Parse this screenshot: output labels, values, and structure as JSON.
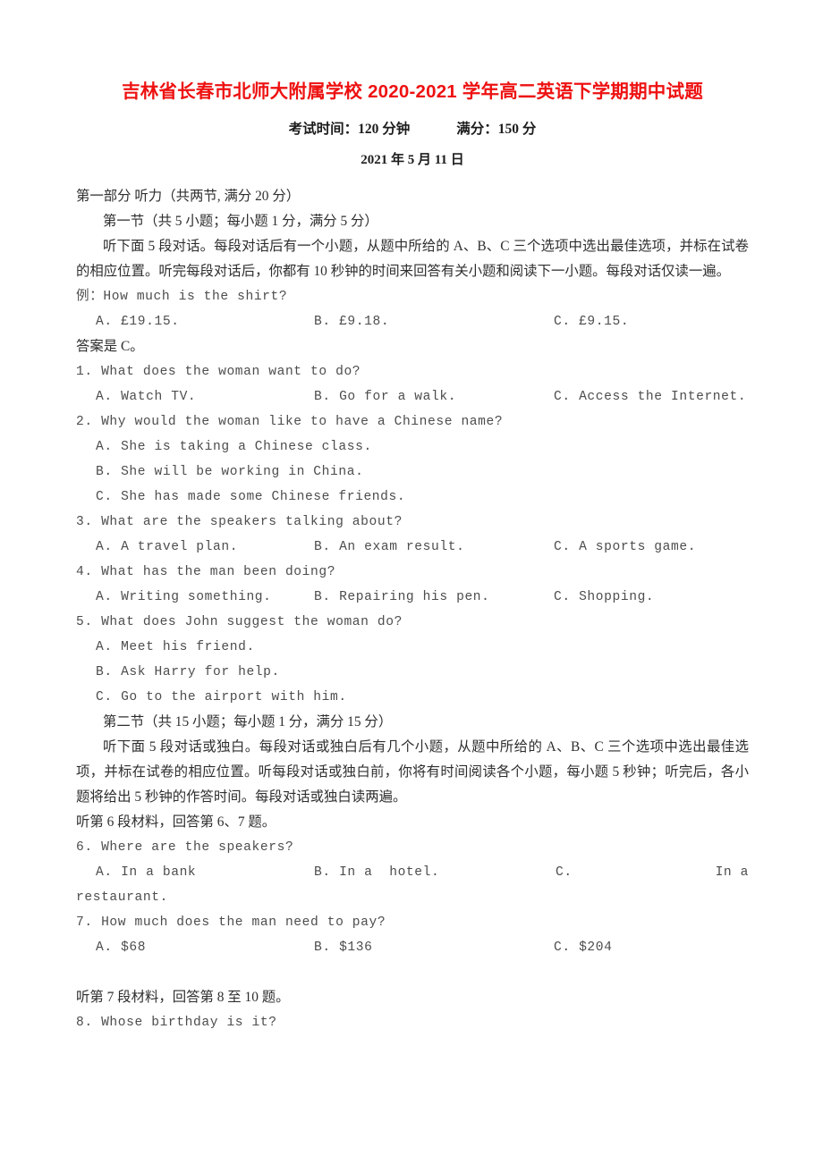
{
  "document": {
    "title": "吉林省长春市北师大附属学校 2020-2021 学年高二英语下学期期中试题",
    "exam_time_label": "考试时间：120 分钟",
    "full_marks_label": "满分：150 分",
    "date": "2021 年 5 月 11 日"
  },
  "part_one": {
    "heading": "第一部分 听力（共两节, 满分 20 分）",
    "section_one": {
      "heading": "第一节（共 5 小题；每小题 1 分，满分 5 分）",
      "instructions": "听下面 5 段对话。每段对话后有一个小题，从题中所给的 A、B、C 三个选项中选出最佳选项，并标在试卷的相应位置。听完每段对话后，你都有 10 秒钟的时间来回答有关小题和阅读下一小题。每段对话仅读一遍。",
      "example_label": "例：How much is the shirt?",
      "example_options": {
        "a": "A. £19.15.",
        "b": "B. £9.18.",
        "c": "C. £9.15."
      },
      "answer_line": "答案是 C。",
      "questions": [
        {
          "number": "1.",
          "stem": "1. What does the woman want to do?",
          "layout": "row",
          "options": {
            "a": "A. Watch TV.",
            "b": "B. Go for a walk.",
            "c": "C. Access the Internet."
          }
        },
        {
          "number": "2.",
          "stem": "2. Why would the woman like to have a Chinese name?",
          "layout": "stack",
          "options": {
            "a": "A. She is taking a Chinese class.",
            "b": "B. She will be working in China.",
            "c": "C. She has made some Chinese friends."
          }
        },
        {
          "number": "3.",
          "stem": "3. What are the speakers talking about?",
          "layout": "row",
          "options": {
            "a": "A. A travel plan.",
            "b": "B. An exam result.",
            "c": "C. A sports game."
          }
        },
        {
          "number": "4.",
          "stem": "4. What has the man been doing?",
          "layout": "row",
          "options": {
            "a": "A. Writing something.",
            "b": "B. Repairing his pen.",
            "c": "C. Shopping."
          }
        },
        {
          "number": "5.",
          "stem": "5. What does John suggest the woman do?",
          "layout": "stack",
          "options": {
            "a": "A. Meet his friend.",
            "b": "B. Ask Harry for help.",
            "c": "C. Go to the airport with him."
          }
        }
      ]
    },
    "section_two": {
      "heading": "第二节（共 15 小题；每小题 1 分，满分 15 分）",
      "instructions": "听下面 5 段对话或独白。每段对话或独白后有几个小题，从题中所给的 A、B、C 三个选项中选出最佳选项，并标在试卷的相应位置。听每段对话或独白前，你将有时间阅读各个小题，每小题 5 秒钟；听完后，各小题将给出 5 秒钟的作答时间。每段对话或独白读两遍。",
      "material_6_label": "听第 6 段材料，回答第 6、7 题。",
      "material_7_label": "听第 7 段材料，回答第 8 至 10 题。",
      "questions": [
        {
          "number": "6.",
          "stem": "6. Where are the speakers?",
          "layout": "justify",
          "options": {
            "a": "A. In a bank",
            "b": "B. In a  hotel.",
            "c": "C.",
            "c_tail": "In a",
            "c_wrap": "restaurant."
          }
        },
        {
          "number": "7.",
          "stem": "7. How much does the man need to pay?",
          "layout": "row",
          "options": {
            "a": "A. $68",
            "b": "B. $136",
            "c": "C. $204"
          }
        },
        {
          "number": "8.",
          "stem": "8. Whose birthday is it?",
          "layout": "none",
          "options": {}
        }
      ]
    }
  }
}
